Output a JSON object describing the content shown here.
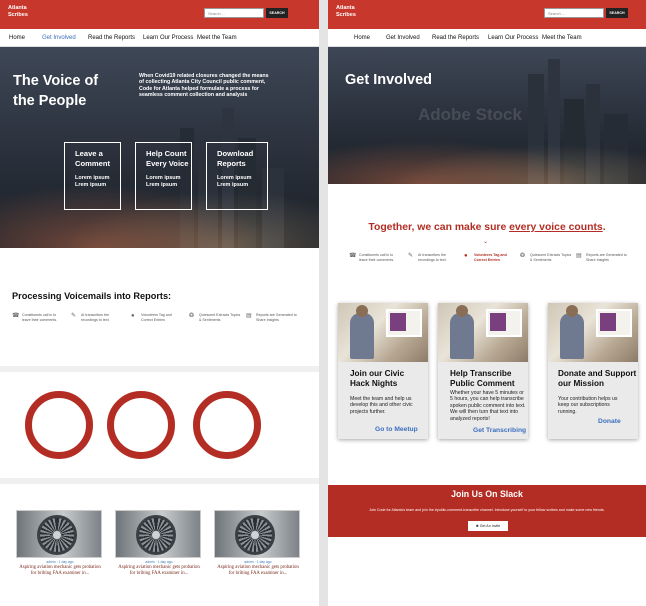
{
  "site": {
    "logo_line1": "Atlanta",
    "logo_line2": "Scribes",
    "search_placeholder": "Search ...",
    "search_button": "SEARCH",
    "nav": [
      "Home",
      "Get Involved",
      "Read the Reports",
      "Learn Our Process",
      "Meet the Team"
    ],
    "colors": {
      "brand_red": "#c7372b",
      "dark_red": "#b32d24",
      "link_blue": "#3c6fbf"
    }
  },
  "left_page": {
    "hero_title_line1": "The Voice of",
    "hero_title_line2": "the People",
    "hero_paragraph": "When Covid19 related closures changed the means of collecting Atlanta City Council public comment, Code for Atlanta helped formulate a process for seamless comment collection and analysis",
    "actions": [
      {
        "title": "Leave a Comment",
        "line1": "Lorem ipsum",
        "line2": "Lrem ipsum"
      },
      {
        "title": "Help Count Every Voice",
        "line1": "Lorem ipsum",
        "line2": "Lrem ipsum"
      },
      {
        "title": "Download Reports",
        "line1": "Lorem ipsum",
        "line2": "Lrem ipsum"
      }
    ],
    "process_title": "Processing Voicemails into Reports:",
    "steps": [
      {
        "icon": "phone-icon",
        "text": "Constituents call in to leave their comments."
      },
      {
        "icon": "edit-icon",
        "text": "AI transcribes the recordings to text."
      },
      {
        "icon": "users-icon",
        "text": "Volunteers Tag and Correct Entries"
      },
      {
        "icon": "brain-icon",
        "text": "Quiescent Extracts Topics & Sentiments"
      },
      {
        "icon": "document-icon",
        "text": "Reports are Generated to Share Insights"
      }
    ],
    "posts": [
      {
        "meta": "admin · 1 day ago",
        "title": "Aspiring aviation mechanic gets probation for bribing FAA examiner in..."
      },
      {
        "meta": "admin · 1 day ago",
        "title": "Aspiring aviation mechanic gets probation for bribing FAA examiner in..."
      },
      {
        "meta": "admin · 1 day ago",
        "title": "Aspiring aviation mechanic gets probation for bribing FAA examiner in..."
      }
    ]
  },
  "right_page": {
    "hero_title": "Get Involved",
    "watermark": "Adobe Stock",
    "tagline_pre": "Together, we can make sure ",
    "tagline_emph": "every voice counts",
    "tagline_post": ".",
    "steps": [
      {
        "icon": "phone-icon",
        "text": "Constituents call in to leave their comments."
      },
      {
        "icon": "edit-icon",
        "text": "AI transcribes the recordings to text."
      },
      {
        "icon": "users-icon",
        "text": "Volunteers Tag and Correct Entries"
      },
      {
        "icon": "brain-icon",
        "text": "Quiescent Extracts Topics & Sentiments"
      },
      {
        "icon": "document-icon",
        "text": "Reports are Generated to Share Insights"
      }
    ],
    "cards": [
      {
        "title": "Join our Civic Hack Nights",
        "body": "Meet the team and help us develop this and other civic projects further.",
        "link": "Go to Meetup"
      },
      {
        "title": "Help Transcribe Public Comment",
        "body": "Whether your have 5 minutes or 5 hours, you can help transcribe spoken public comment into text. We will then turn that text into analyzed reports!",
        "link": "Get Transcribing"
      },
      {
        "title": "Donate and Support our Mission",
        "body": "Your contribution helps us keep our subscriptions running.",
        "link": "Donate"
      }
    ],
    "slack_title": "Join Us On Slack",
    "slack_text": "Join Code for Atlanta's team and join the #public-comment-transcribe channel. Introduce yourself to your fellow scribes and make some new friends.",
    "slack_button": "Get An Invite"
  }
}
